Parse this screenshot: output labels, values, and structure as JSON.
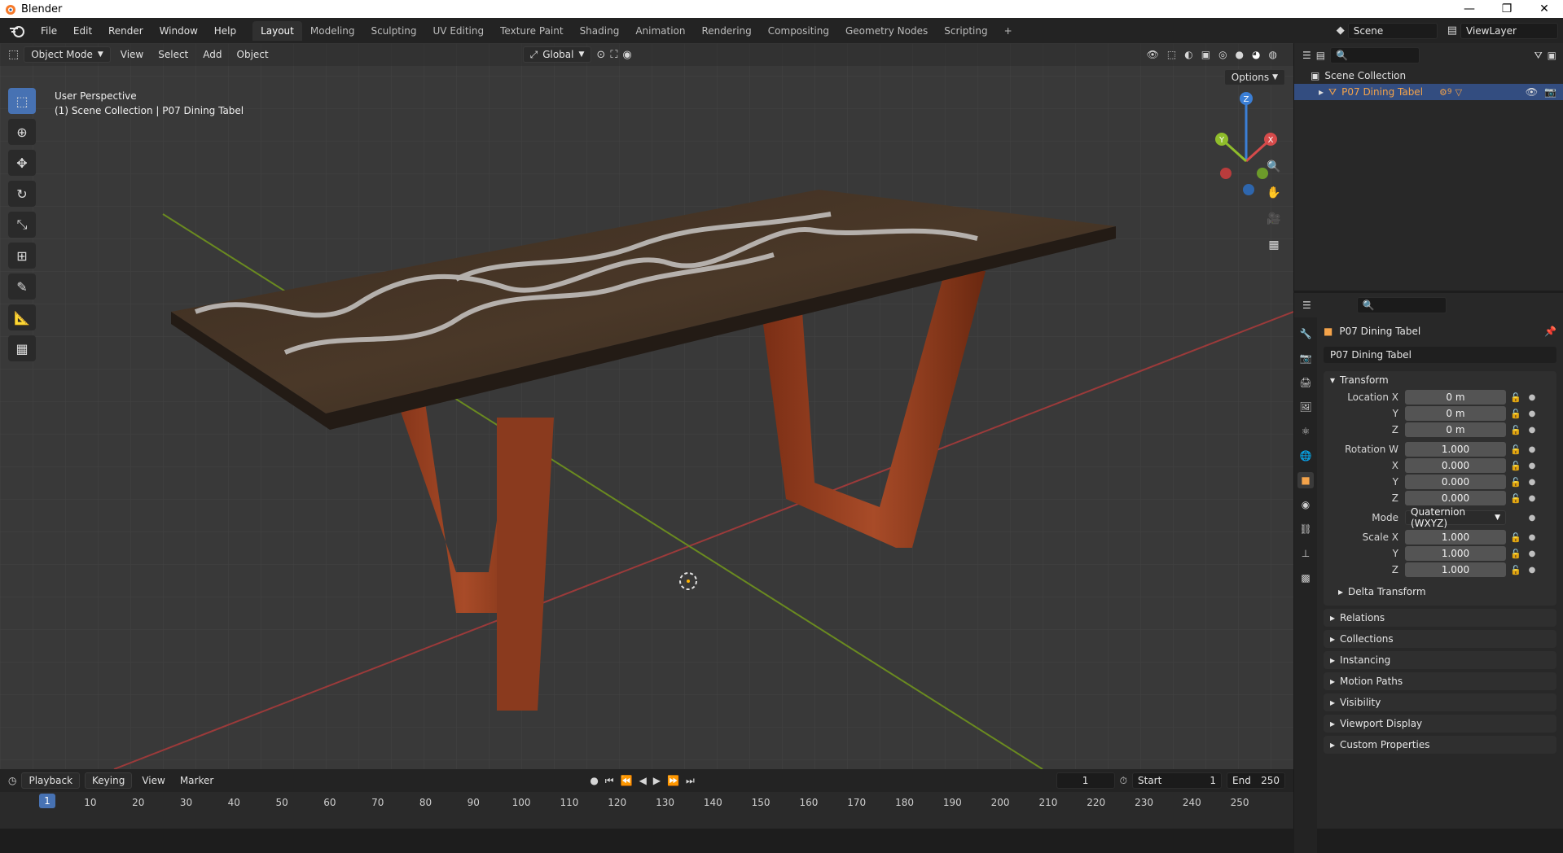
{
  "window": {
    "title": "Blender",
    "controls": [
      "—",
      "❐",
      "✕"
    ]
  },
  "menubar": {
    "items": [
      "File",
      "Edit",
      "Render",
      "Window",
      "Help"
    ]
  },
  "workspaces": {
    "tabs": [
      "Layout",
      "Modeling",
      "Sculpting",
      "UV Editing",
      "Texture Paint",
      "Shading",
      "Animation",
      "Rendering",
      "Compositing",
      "Geometry Nodes",
      "Scripting"
    ],
    "active": "Layout",
    "add_label": "+"
  },
  "topright": {
    "scene": "Scene",
    "view_layer": "ViewLayer"
  },
  "viewport": {
    "mode": "Object Mode",
    "menu": [
      "View",
      "Select",
      "Add",
      "Object"
    ],
    "transform_orientation": "Global",
    "options_label": "Options",
    "info_line1": "User Perspective",
    "info_line2": "(1) Scene Collection | P07 Dining Tabel",
    "gizmo": {
      "x": "X",
      "y": "Y",
      "z": "Z"
    }
  },
  "outliner": {
    "root": "Scene Collection",
    "items": [
      {
        "name": "P07 Dining Tabel",
        "selected": true,
        "badge": "9"
      }
    ]
  },
  "properties": {
    "object_name": "P07 Dining Tabel",
    "object_field": "P07 Dining Tabel",
    "transform": {
      "title": "Transform",
      "location_x_label": "Location X",
      "location_x": "0 m",
      "location_y_label": "Y",
      "location_y": "0 m",
      "location_z_label": "Z",
      "location_z": "0 m",
      "rotation_w_label": "Rotation W",
      "rotation_w": "1.000",
      "rotation_x_label": "X",
      "rotation_x": "0.000",
      "rotation_y_label": "Y",
      "rotation_y": "0.000",
      "rotation_z_label": "Z",
      "rotation_z": "0.000",
      "mode_label": "Mode",
      "mode_value": "Quaternion (WXYZ)",
      "scale_x_label": "Scale X",
      "scale_x": "1.000",
      "scale_y_label": "Y",
      "scale_y": "1.000",
      "scale_z_label": "Z",
      "scale_z": "1.000",
      "delta_label": "Delta Transform"
    },
    "sections": [
      "Relations",
      "Collections",
      "Instancing",
      "Motion Paths",
      "Visibility",
      "Viewport Display",
      "Custom Properties"
    ]
  },
  "timeline": {
    "menu": [
      "Playback",
      "Keying",
      "View",
      "Marker"
    ],
    "current_frame": "1",
    "start_label": "Start",
    "start_value": "1",
    "end_label": "End",
    "end_value": "250",
    "ticks": [
      "1",
      "10",
      "20",
      "30",
      "40",
      "50",
      "60",
      "70",
      "80",
      "90",
      "100",
      "110",
      "120",
      "130",
      "140",
      "150",
      "160",
      "170",
      "180",
      "190",
      "200",
      "210",
      "220",
      "230",
      "240",
      "250"
    ]
  },
  "colors": {
    "accent": "#4772b3",
    "selection_orange": "#f4a34a",
    "viewport_bg": "#393939",
    "axis_red": "#d64b4b",
    "axis_green": "#8fbd2b"
  }
}
